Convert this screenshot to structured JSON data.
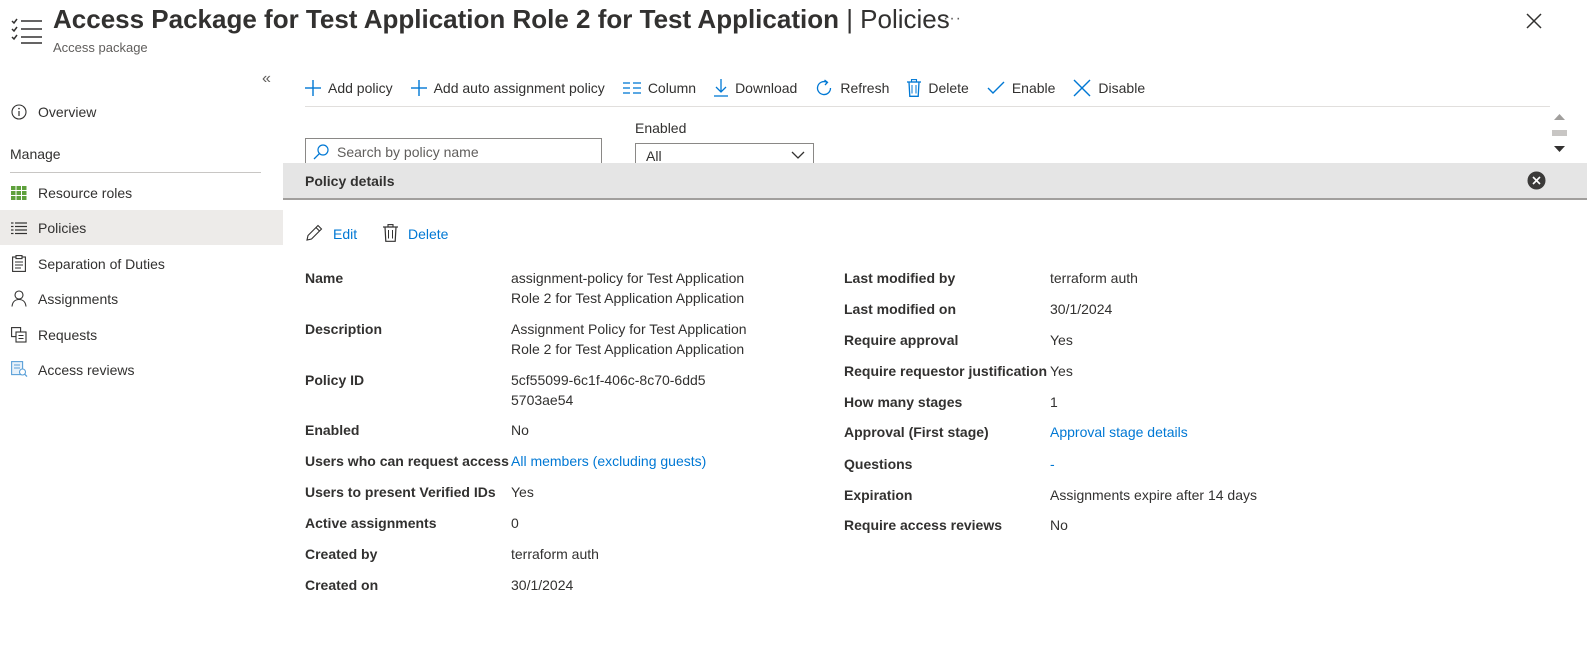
{
  "header": {
    "title_main": "Access Package for Test Application Role 2 for Test Application",
    "title_separator": " | ",
    "title_section": "Policies",
    "subtitle": "Access package",
    "more": "···"
  },
  "sidebar": {
    "collapse": "«",
    "overview": "Overview",
    "manage_label": "Manage",
    "items": [
      {
        "label": "Resource roles",
        "icon": "grid-icon"
      },
      {
        "label": "Policies",
        "icon": "list-icon"
      },
      {
        "label": "Separation of Duties",
        "icon": "clipboard-icon"
      },
      {
        "label": "Assignments",
        "icon": "person-icon"
      },
      {
        "label": "Requests",
        "icon": "requests-icon"
      },
      {
        "label": "Access reviews",
        "icon": "access-review-icon"
      }
    ]
  },
  "toolbar": {
    "add_policy": "Add policy",
    "add_auto": "Add auto assignment policy",
    "column": "Column",
    "download": "Download",
    "refresh": "Refresh",
    "delete": "Delete",
    "enable": "Enable",
    "disable": "Disable"
  },
  "filters": {
    "search_placeholder": "Search by policy name",
    "enabled_label": "Enabled",
    "enabled_value": "All"
  },
  "details": {
    "title": "Policy details",
    "edit": "Edit",
    "delete": "Delete",
    "left": [
      {
        "label": "Name",
        "value": "assignment-policy for Test Application Role 2 for Test Application Application"
      },
      {
        "label": "Description",
        "value": "Assignment Policy for Test Application Role 2 for Test Application Application"
      },
      {
        "label": "Policy ID",
        "value": "5cf55099-6c1f-406c-8c70-6dd55703ae54"
      },
      {
        "label": "Enabled",
        "value": "No"
      },
      {
        "label": "Users who can request access",
        "value": "All members (excluding guests)"
      },
      {
        "label": "Users to present Verified IDs",
        "value": "Yes"
      },
      {
        "label": "Active assignments",
        "value": "0"
      },
      {
        "label": "Created by",
        "value": "terraform auth"
      },
      {
        "label": "Created on",
        "value": "30/1/2024"
      }
    ],
    "right": [
      {
        "label": "Last modified by",
        "value": "terraform auth"
      },
      {
        "label": "Last modified on",
        "value": "30/1/2024"
      },
      {
        "label": "Require approval",
        "value": "Yes"
      },
      {
        "label": "Require requestor justification",
        "value": "Yes"
      },
      {
        "label": "How many stages",
        "value": "1"
      },
      {
        "label": "Approval (First stage)",
        "value": "Approval stage details"
      },
      {
        "label": "Questions",
        "value": "-"
      },
      {
        "label": "Expiration",
        "value": "Assignments expire after 14 days"
      },
      {
        "label": "Require access reviews",
        "value": "No"
      }
    ]
  }
}
